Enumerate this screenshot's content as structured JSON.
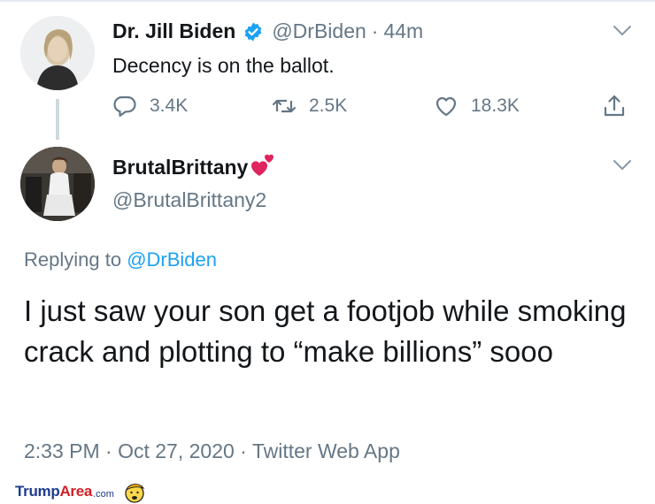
{
  "tweet1": {
    "name": "Dr. Jill Biden",
    "handle": "@DrBiden",
    "separator": "·",
    "time": "44m",
    "text": "Decency is on the ballot.",
    "replies": "3.4K",
    "retweets": "2.5K",
    "likes": "18.3K"
  },
  "tweet2": {
    "name": "BrutalBrittany",
    "handle": "@BrutalBrittany2",
    "replying_prefix": "Replying to ",
    "replying_to": "@DrBiden",
    "text": "I just saw your son get a footjob while smoking crack and plotting to “make billions” sooo",
    "timestamp": "2:33 PM · Oct 27, 2020 · Twitter Web App"
  },
  "watermark": {
    "trump": "Trump",
    "area": "Area",
    "com": ".com"
  },
  "icons": {
    "verified": "verified-badge-icon",
    "reply": "reply-icon",
    "retweet": "retweet-icon",
    "like": "heart-icon",
    "share": "share-icon",
    "menu": "chevron-down-icon"
  },
  "colors": {
    "accent": "#1da1f2",
    "muted": "#657786",
    "text": "#14171a",
    "emoji_heart": "#e0245e"
  }
}
